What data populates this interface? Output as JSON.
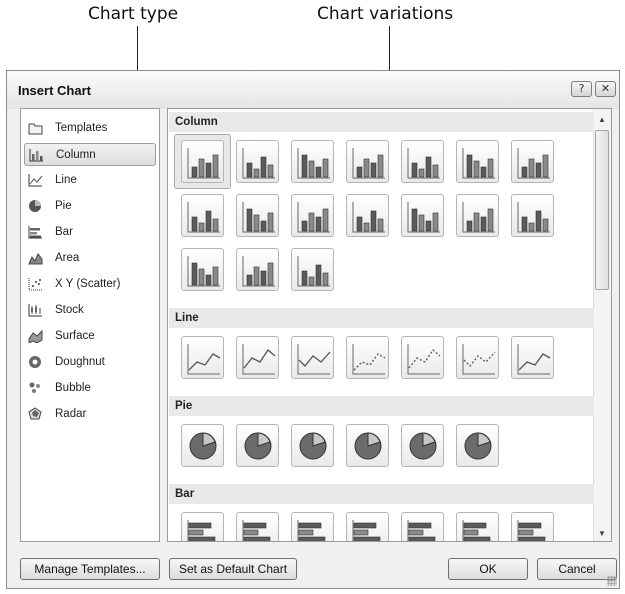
{
  "annotations": {
    "chart_type": "Chart type",
    "chart_variations": "Chart variations"
  },
  "dialog": {
    "title": "Insert Chart",
    "title_buttons": {
      "help": "?",
      "close": "✕"
    },
    "sidebar": {
      "items": [
        {
          "label": "Templates",
          "icon": "folder-icon",
          "selected": false
        },
        {
          "label": "Column",
          "icon": "column-chart-icon",
          "selected": true
        },
        {
          "label": "Line",
          "icon": "line-chart-icon",
          "selected": false
        },
        {
          "label": "Pie",
          "icon": "pie-chart-icon",
          "selected": false
        },
        {
          "label": "Bar",
          "icon": "bar-chart-icon",
          "selected": false
        },
        {
          "label": "Area",
          "icon": "area-chart-icon",
          "selected": false
        },
        {
          "label": "X Y (Scatter)",
          "icon": "scatter-chart-icon",
          "selected": false
        },
        {
          "label": "Stock",
          "icon": "stock-chart-icon",
          "selected": false
        },
        {
          "label": "Surface",
          "icon": "surface-chart-icon",
          "selected": false
        },
        {
          "label": "Doughnut",
          "icon": "doughnut-chart-icon",
          "selected": false
        },
        {
          "label": "Bubble",
          "icon": "bubble-chart-icon",
          "selected": false
        },
        {
          "label": "Radar",
          "icon": "radar-chart-icon",
          "selected": false
        }
      ]
    },
    "gallery": {
      "sections": [
        {
          "name": "Column",
          "count": 17,
          "selected_index": 0
        },
        {
          "name": "Line",
          "count": 7
        },
        {
          "name": "Pie",
          "count": 6
        },
        {
          "name": "Bar",
          "count": 7
        }
      ]
    },
    "buttons": {
      "manage_templates": "Manage Templates...",
      "set_default": "Set as Default Chart",
      "ok": "OK",
      "cancel": "Cancel"
    }
  }
}
